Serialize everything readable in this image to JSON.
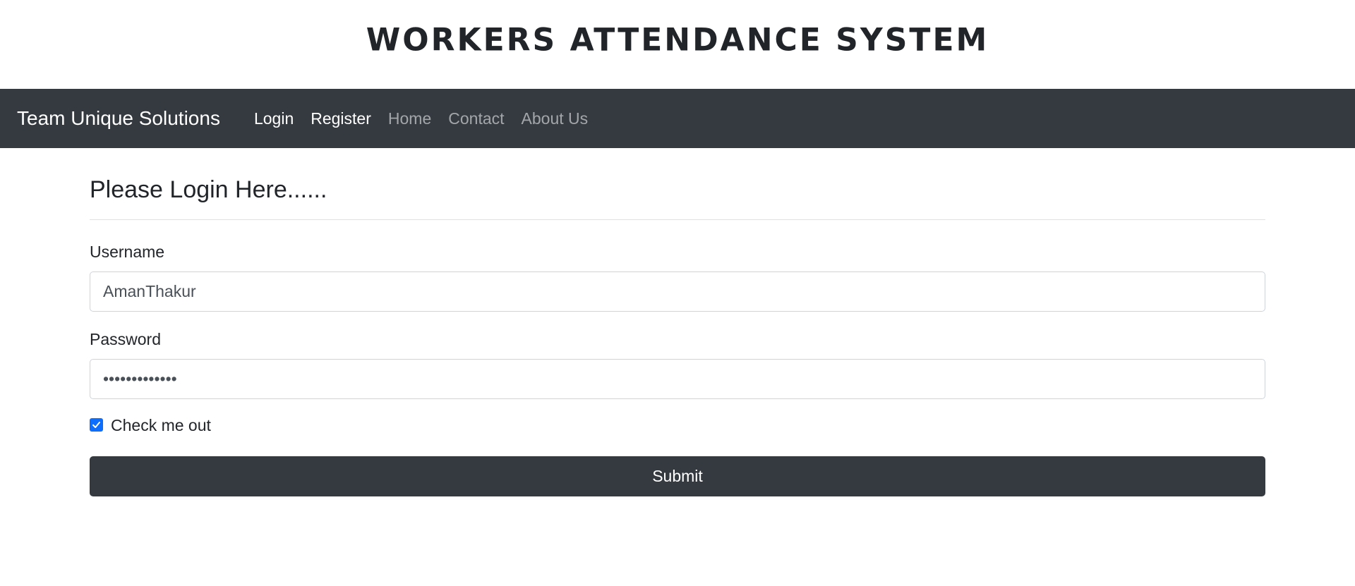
{
  "header": {
    "title": "WORKERS ATTENDANCE SYSTEM"
  },
  "navbar": {
    "brand": "Team Unique Solutions",
    "links": [
      {
        "label": "Login",
        "state": "active"
      },
      {
        "label": "Register",
        "state": "active"
      },
      {
        "label": "Home",
        "state": "muted"
      },
      {
        "label": "Contact",
        "state": "muted"
      },
      {
        "label": "About Us",
        "state": "muted"
      }
    ]
  },
  "form": {
    "heading": "Please Login Here......",
    "username": {
      "label": "Username",
      "value": "AmanThakur"
    },
    "password": {
      "label": "Password",
      "value": "•••••••••••••"
    },
    "checkbox": {
      "label": "Check me out",
      "checked": true
    },
    "submit_label": "Submit"
  },
  "colors": {
    "navbar_bg": "#343a40",
    "checkbox_accent": "#0d6efd"
  },
  "icons": {
    "checkbox": "checkmark-icon"
  }
}
